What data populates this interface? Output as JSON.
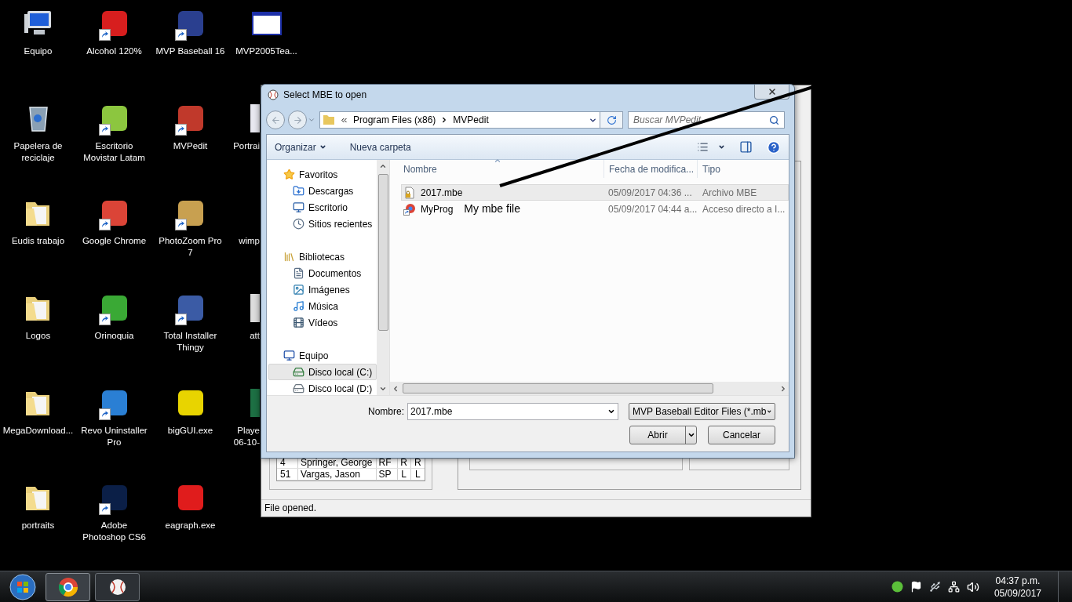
{
  "desktop": {
    "columns": [
      [
        {
          "lines": [
            "Equipo"
          ],
          "kind": "computer",
          "shortcut": false,
          "covered": false
        },
        {
          "lines": [
            "Papelera de",
            "reciclaje"
          ],
          "kind": "recycle",
          "shortcut": false,
          "covered": false
        },
        {
          "lines": [
            "Eudis trabajo"
          ],
          "kind": "folder",
          "shortcut": false,
          "covered": false
        },
        {
          "lines": [
            "Logos"
          ],
          "kind": "folder",
          "shortcut": false,
          "covered": false
        },
        {
          "lines": [
            "MegaDownload..."
          ],
          "kind": "folder",
          "shortcut": false,
          "covered": false
        },
        {
          "lines": [
            "portraits"
          ],
          "kind": "folder",
          "shortcut": false,
          "covered": false
        }
      ],
      [
        {
          "lines": [
            "Alcohol 120%"
          ],
          "kind": "app",
          "color": "#d71e1e",
          "shortcut": true,
          "covered": false
        },
        {
          "lines": [
            "Escritorio",
            "Movistar Latam"
          ],
          "kind": "app",
          "color": "#8cc63f",
          "shortcut": true,
          "covered": false
        },
        {
          "lines": [
            "Google Chrome"
          ],
          "kind": "app",
          "color": "#db4437",
          "shortcut": true,
          "covered": false
        },
        {
          "lines": [
            "Orinoquia"
          ],
          "kind": "app",
          "color": "#3aa935",
          "shortcut": true,
          "covered": false
        },
        {
          "lines": [
            "Revo Uninstaller",
            "Pro"
          ],
          "kind": "app",
          "color": "#2a7fd4",
          "shortcut": true,
          "covered": false
        },
        {
          "lines": [
            "Adobe",
            "Photoshop CS6"
          ],
          "kind": "app",
          "color": "#0b1f47",
          "shortcut": true,
          "covered": false
        }
      ],
      [
        {
          "lines": [
            "MVP Baseball 16"
          ],
          "kind": "app",
          "color": "#2a3f8f",
          "shortcut": true,
          "covered": false
        },
        {
          "lines": [
            "MVPedit"
          ],
          "kind": "app",
          "color": "#c0392b",
          "shortcut": true,
          "covered": false
        },
        {
          "lines": [
            "PhotoZoom Pro",
            "7"
          ],
          "kind": "app",
          "color": "#c8a050",
          "shortcut": true,
          "covered": false
        },
        {
          "lines": [
            "Total Installer",
            "Thingy"
          ],
          "kind": "app",
          "color": "#3b5ba5",
          "shortcut": true,
          "covered": false
        },
        {
          "lines": [
            "bigGUI.exe"
          ],
          "kind": "app",
          "color": "#e8d400",
          "shortcut": false,
          "covered": false
        },
        {
          "lines": [
            "eagraph.exe"
          ],
          "kind": "app",
          "color": "#e01c1c",
          "shortcut": false,
          "covered": false
        }
      ],
      [
        {
          "lines": [
            "MVP2005Tea..."
          ],
          "kind": "window",
          "shortcut": false,
          "covered": false
        },
        {
          "lines": [
            "Portrai"
          ],
          "kind": "app",
          "color": "#e8e8f0",
          "shortcut": false,
          "covered": true
        },
        {
          "lines": [
            "wimp"
          ],
          "kind": "hidden",
          "shortcut": false,
          "covered": true
        },
        {
          "lines": [
            "att"
          ],
          "kind": "app",
          "color": "#dddddd",
          "shortcut": false,
          "covered": true
        },
        {
          "lines": [
            "Playe",
            "06-10-"
          ],
          "kind": "app",
          "color": "#1d7044",
          "shortcut": false,
          "covered": true
        }
      ]
    ]
  },
  "background_window": {
    "rows": [
      {
        "number": "4",
        "name": "Springer, George",
        "position": "RF",
        "bats": "R",
        "throws": "R"
      },
      {
        "number": "51",
        "name": "Vargas, Jason",
        "position": "SP",
        "bats": "L",
        "throws": "L"
      }
    ],
    "status": "File opened."
  },
  "dialog": {
    "title": "Select MBE to open",
    "path": [
      "Program Files (x86)",
      "MVPedit"
    ],
    "search": {
      "placeholder": "Buscar MVPedit"
    },
    "toolbar": [
      "Organizar",
      "Nueva carpeta"
    ],
    "nav_tree": [
      {
        "label": "Favoritos",
        "kind": "star",
        "selected": false,
        "children": [
          {
            "label": "Descargas",
            "kind": "downloads",
            "selected": false
          },
          {
            "label": "Escritorio",
            "kind": "desktop",
            "selected": false
          },
          {
            "label": "Sitios recientes",
            "kind": "recent",
            "selected": false
          }
        ]
      },
      {
        "label": "Bibliotecas",
        "kind": "library",
        "selected": false,
        "children": [
          {
            "label": "Documentos",
            "kind": "document",
            "selected": false
          },
          {
            "label": "Imágenes",
            "kind": "image",
            "selected": false
          },
          {
            "label": "Música",
            "kind": "music",
            "selected": false
          },
          {
            "label": "Vídeos",
            "kind": "video",
            "selected": false
          }
        ]
      },
      {
        "label": "Equipo",
        "kind": "computer",
        "selected": false,
        "children": [
          {
            "label": "Disco local (C:)",
            "kind": "system_drive",
            "selected": true
          },
          {
            "label": "Disco local (D:)",
            "kind": "drive",
            "selected": false
          }
        ]
      }
    ],
    "columns": [
      "Nombre",
      "Fecha de modifica...",
      "Tipo"
    ],
    "files": [
      {
        "name": "2017.mbe",
        "date": "05/09/2017 04:36 ...",
        "type": "Archivo MBE",
        "kind": "locked_file",
        "selected": true
      },
      {
        "name": "MyProg",
        "note": "My mbe file",
        "date": "05/09/2017 04:44 a...",
        "type": "Acceso directo a I...",
        "kind": "shortcut",
        "selected": false
      }
    ],
    "filename_label": "Nombre:",
    "filename": "2017.mbe",
    "filter": "MVP Baseball Editor Files (*.mb",
    "buttons": [
      "Abrir",
      "Cancelar"
    ]
  },
  "taskbar": {
    "time": "04:37 p.m.",
    "date": "05/09/2017"
  }
}
